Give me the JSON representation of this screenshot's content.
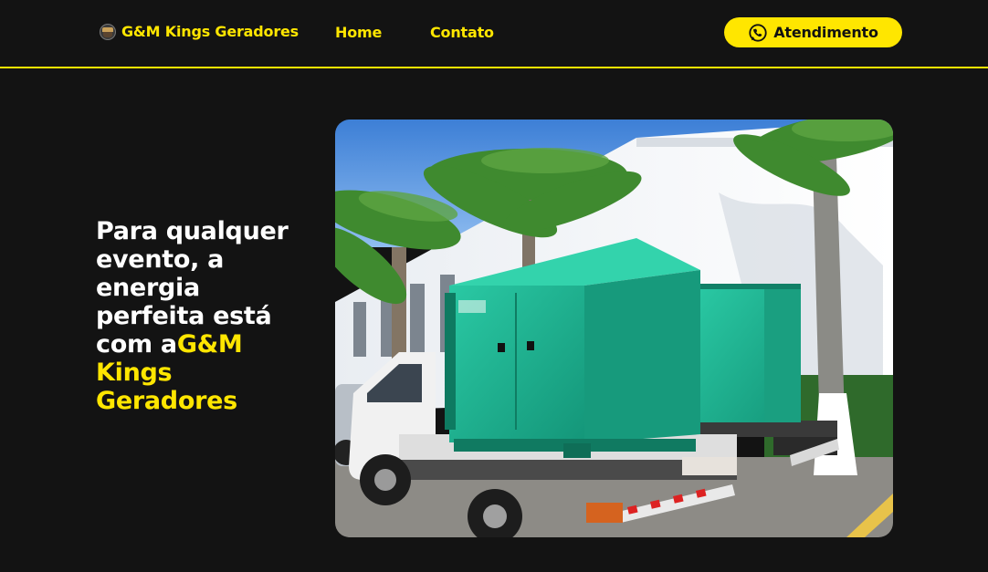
{
  "header": {
    "brand_name": "G&M Kings Geradores",
    "nav": {
      "home_label": "Home",
      "contact_label": "Contato"
    },
    "cta_label": "Atendimento"
  },
  "hero": {
    "title_text": "Para qualquer evento, a energia perfeita está com a",
    "title_highlight": "G&M Kings Geradores"
  },
  "colors": {
    "background": "#131313",
    "accent": "#ffe600",
    "text": "#ffffff",
    "generator": "#1fb594"
  },
  "icons": {
    "cta_icon": "whatsapp-icon",
    "brand_icon": "brand-logo"
  }
}
